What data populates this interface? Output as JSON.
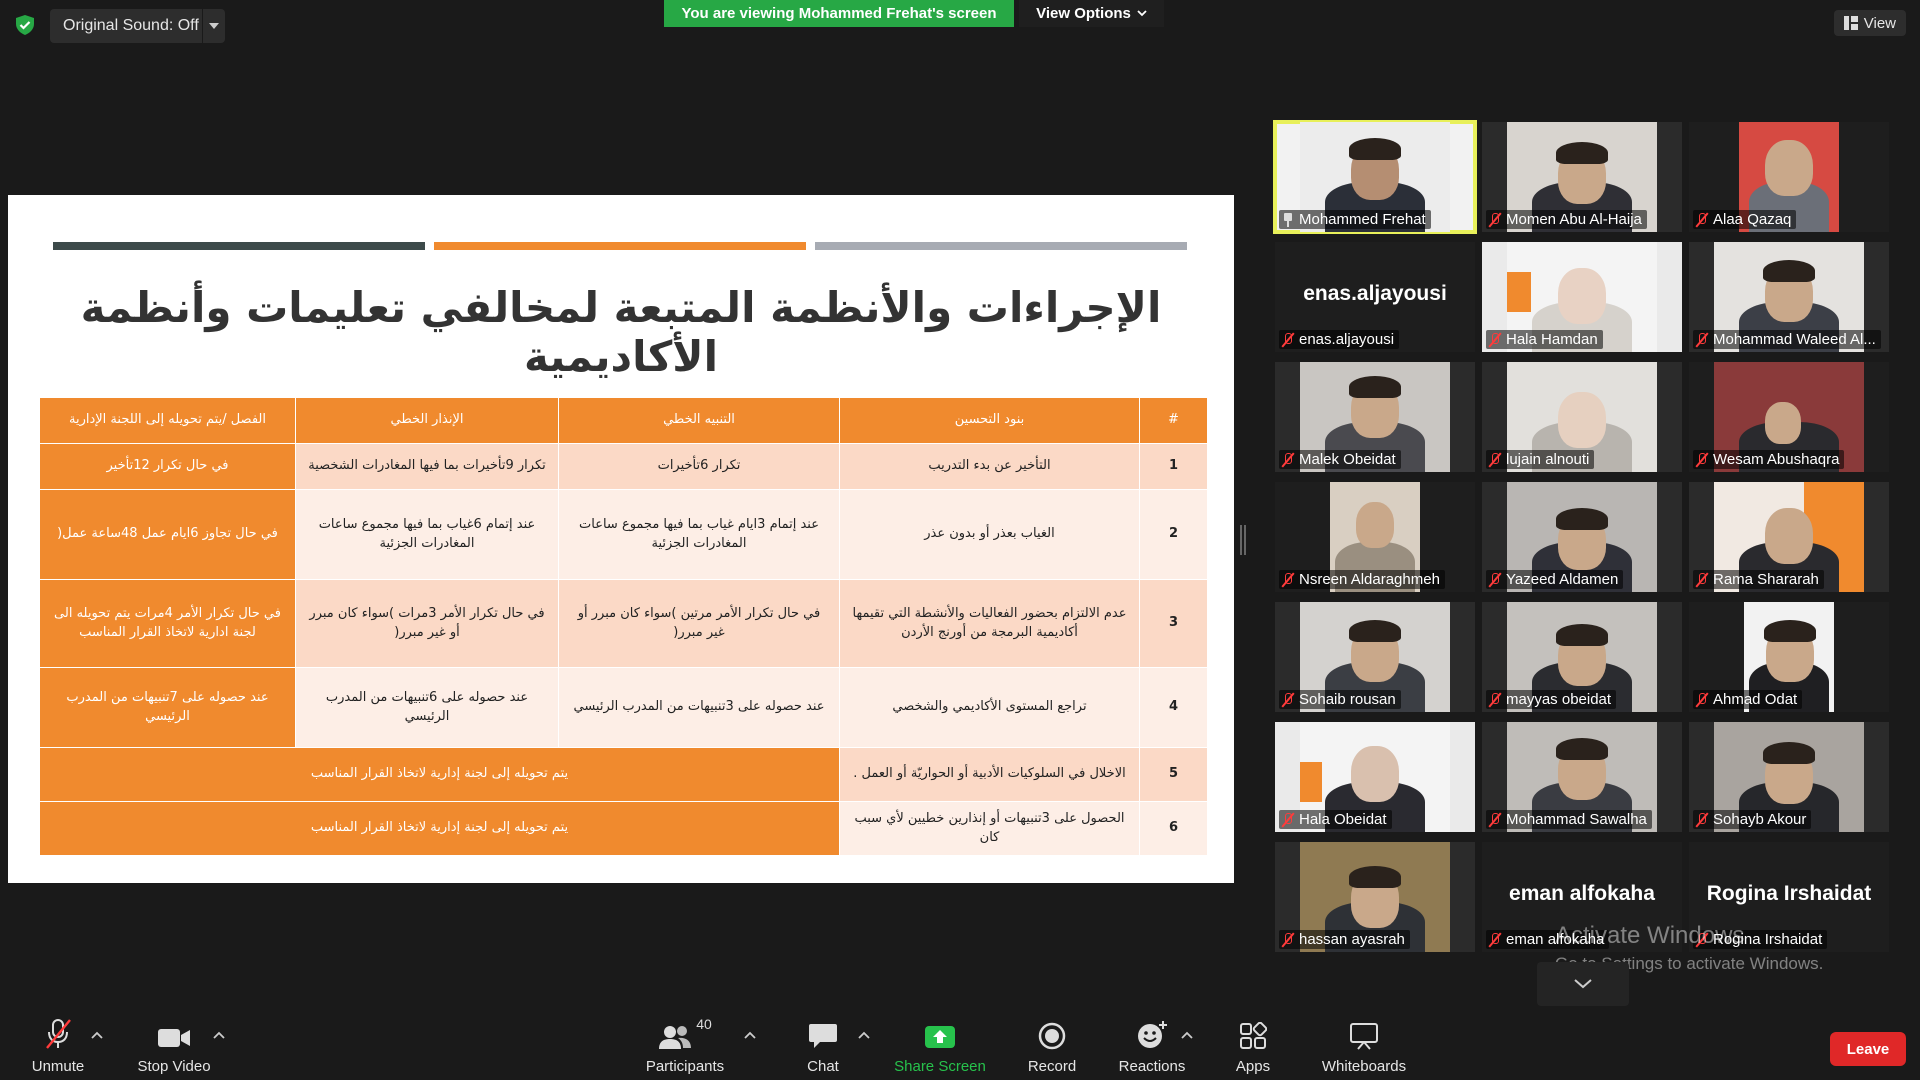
{
  "topbar": {
    "original_sound_label": "Original Sound: Off",
    "viewing_banner": "You are viewing Mohammed Frehat's screen",
    "view_options_label": "View Options",
    "view_label": "View"
  },
  "slide": {
    "title": "الإجراءات والأنظمة المتبعة لمخالفي تعليمات وأنظمة الأكاديمية",
    "bar_colors": [
      "#3d4a4a",
      "#f08a2e",
      "#a7abb3"
    ],
    "columns": [
      "#",
      "بنود التحسين",
      "التنبيه الخطي",
      "الإنذار الخطي",
      "الفصل /يتم تحويله إلى اللجنة الإدارية"
    ],
    "rows": [
      {
        "num": "1",
        "item": "التأخير عن بدء التدريب",
        "warning": "تكرار 6تأخيرات",
        "notice": "تكرار 9تأخيرات بما فيها المغادرات الشخصية",
        "dismissal": "في حال تكرار 12تأخير"
      },
      {
        "num": "2",
        "item": "الغياب بعذر أو بدون عذر",
        "warning": "عند إتمام 3ايام غياب بما فيها مجموع ساعات المغادرات الجزئية",
        "notice": "عند إتمام 6غياب بما فيها مجموع ساعات المغادرات الجزئية",
        "dismissal": "في حال تجاوز 6ايام عمل 48ساعة عمل("
      },
      {
        "num": "3",
        "item": "عدم الالتزام بحضور الفعاليات والأنشطة التي تقيمها أكاديمية البرمجة من أورنج الأردن",
        "warning": "في حال تكرار الأمر مرتين )سواء كان مبرر أو غير مبرر(",
        "notice": "في حال تكرار الأمر 3مرات )سواء كان مبرر أو غير مبرر(",
        "dismissal": "في حال تكرار الأمر 4مرات يتم تحويله الى لجنة ادارية لاتخاذ القرار المناسب"
      },
      {
        "num": "4",
        "item": "تراجع المستوى الأكاديمي والشخصي",
        "warning": "عند حصوله على 3تنبيهات من المدرب الرئيسي",
        "notice": "عند حصوله على 6تنبيهات من المدرب الرئيسي",
        "dismissal": "عند حصوله على 7تنبيهات من المدرب الرئيسي"
      },
      {
        "num": "5",
        "item": "الاخلال في السلوكيات الأدبية أو الحواريّة أو العمل .",
        "merged": "يتم تحويله إلى لجنة إدارية لاتخاذ القرار المناسب"
      },
      {
        "num": "6",
        "item": "الحصول على 3تنبيهات أو إنذارين خطيين لأي سبب كان",
        "merged": "يتم تحويله إلى لجنة إدارية لاتخاذ القرار المناسب"
      }
    ]
  },
  "participants": [
    {
      "name": "Mohammed Frehat",
      "video": true,
      "pinned": true,
      "active": true
    },
    {
      "name": "Momen Abu Al-Haija",
      "video": true
    },
    {
      "name": "Alaa Qazaq",
      "video": true
    },
    {
      "name": "enas.aljayousi",
      "video": false,
      "display": "enas.aljayousi"
    },
    {
      "name": "Hala Hamdan",
      "video": true
    },
    {
      "name": "Mohammad Waleed Al...",
      "video": true
    },
    {
      "name": "Malek Obeidat",
      "video": true
    },
    {
      "name": "lujain alnouti",
      "video": true
    },
    {
      "name": "Wesam Abushaqra",
      "video": true
    },
    {
      "name": "Nsreen Aldaraghmeh",
      "video": true
    },
    {
      "name": "Yazeed Aldamen",
      "video": true
    },
    {
      "name": "Rama Shararah",
      "video": true
    },
    {
      "name": "Sohaib rousan",
      "video": true
    },
    {
      "name": "mayyas obeidat",
      "video": true
    },
    {
      "name": "Ahmad Odat",
      "video": true
    },
    {
      "name": "Hala Obeidat",
      "video": true
    },
    {
      "name": "Mohammad Sawalha",
      "video": true
    },
    {
      "name": "Sohayb Akour",
      "video": true
    },
    {
      "name": "hassan ayasrah",
      "video": true
    },
    {
      "name": "eman alfokaha",
      "video": false,
      "display": "eman alfokaha"
    },
    {
      "name": "Rogina Irshaidat",
      "video": false,
      "display": "Rogina Irshaidat"
    }
  ],
  "watermark": {
    "line1": "Activate Windows",
    "line2": "Go to Settings to activate Windows."
  },
  "toolbar": {
    "unmute": "Unmute",
    "stop_video": "Stop Video",
    "participants": "Participants",
    "participants_count": "40",
    "chat": "Chat",
    "share_screen": "Share Screen",
    "record": "Record",
    "reactions": "Reactions",
    "apps": "Apps",
    "whiteboards": "Whiteboards",
    "leave": "Leave"
  }
}
